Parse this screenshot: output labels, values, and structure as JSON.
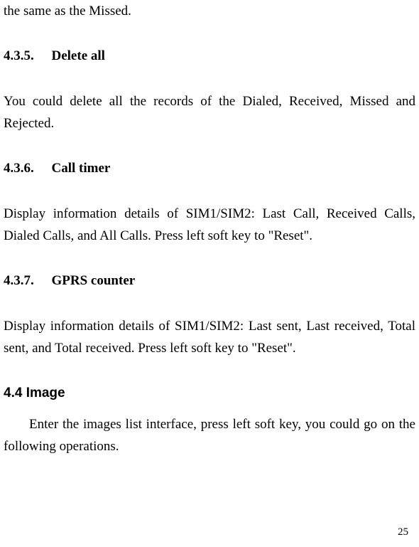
{
  "fragment_top": "the same as the Missed.",
  "sections": {
    "s435": {
      "number": "4.3.5.",
      "title": "Delete all",
      "body": "You could delete all the records of the Dialed, Received, Missed and Rejected."
    },
    "s436": {
      "number": "4.3.6.",
      "title": "Call timer",
      "body": "Display information details of SIM1/SIM2: Last Call, Received Calls, Dialed Calls, and All Calls. Press left soft key to \"Reset\"."
    },
    "s437": {
      "number": "4.3.7.",
      "title": "GPRS counter",
      "body": "Display information details of SIM1/SIM2: Last sent, Last received, Total sent, and Total received. Press left soft key to \"Reset\"."
    },
    "s44": {
      "title": "4.4 Image",
      "body": "Enter the images list interface, press left soft key, you could go on the following operations."
    }
  },
  "page_number": "25"
}
